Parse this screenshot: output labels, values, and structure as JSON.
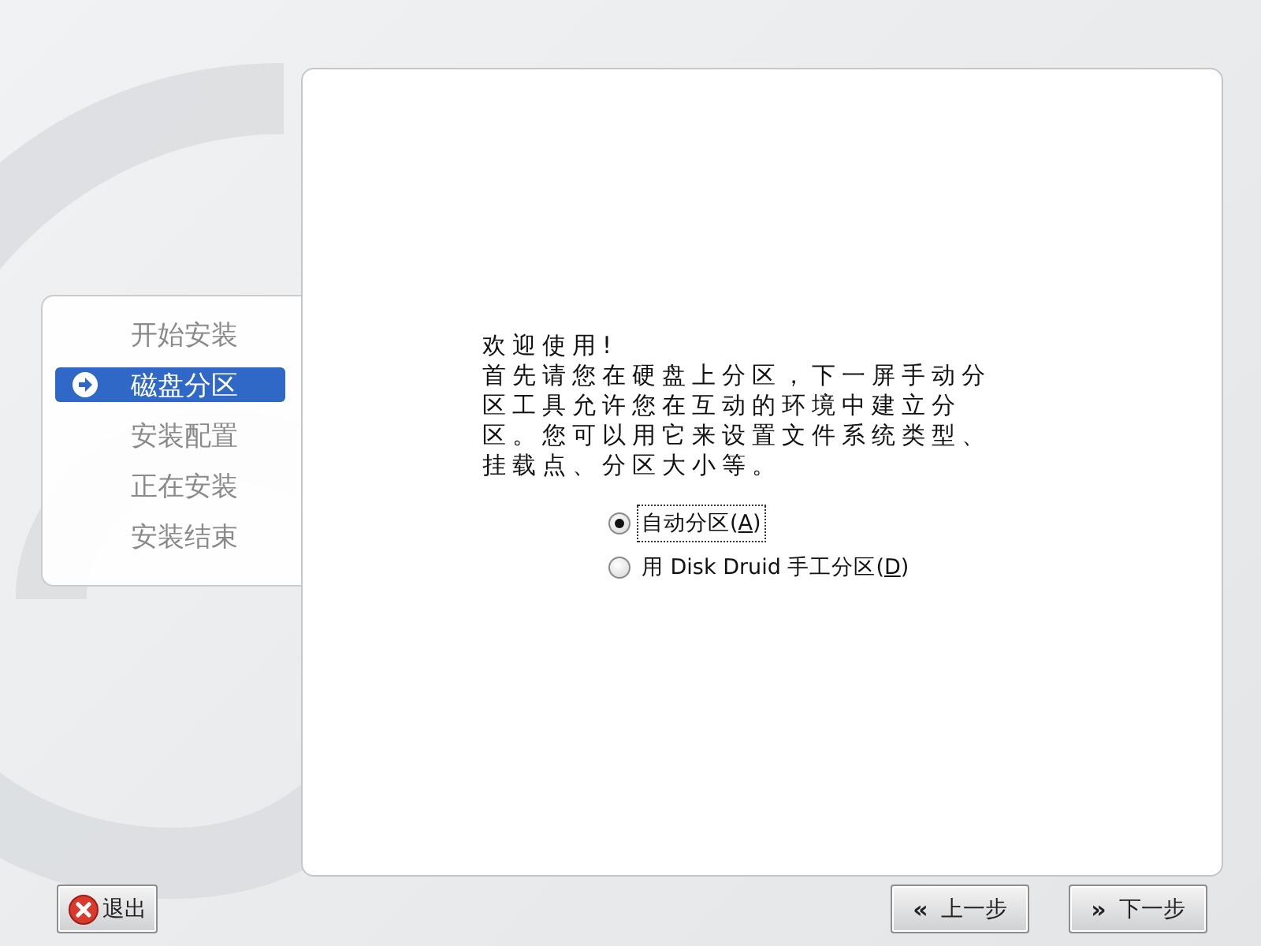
{
  "sidebar": {
    "steps": [
      {
        "label": "开始安装",
        "selected": false
      },
      {
        "label": "磁盘分区",
        "selected": true
      },
      {
        "label": "安装配置",
        "selected": false
      },
      {
        "label": "正在安装",
        "selected": false
      },
      {
        "label": "安装结束",
        "selected": false
      }
    ]
  },
  "content": {
    "heading": "欢迎使用!",
    "paragraph": "首先请您在硬盘上分区，下一屏手动分区工具允许您在互动的环境中建立分区。您可以用它来设置文件系统类型、挂载点、分区大小等。",
    "options": [
      {
        "before": "自动分区(",
        "mnemonic": "A",
        "after": ")",
        "selected": true
      },
      {
        "before": "用 Disk Druid 手工分区(",
        "mnemonic": "D",
        "after": ")",
        "selected": false
      }
    ]
  },
  "buttons": {
    "exit": {
      "label": "退出"
    },
    "back": {
      "icon": "«",
      "label": "上一步"
    },
    "next": {
      "icon": "»",
      "label": "下一步"
    }
  }
}
